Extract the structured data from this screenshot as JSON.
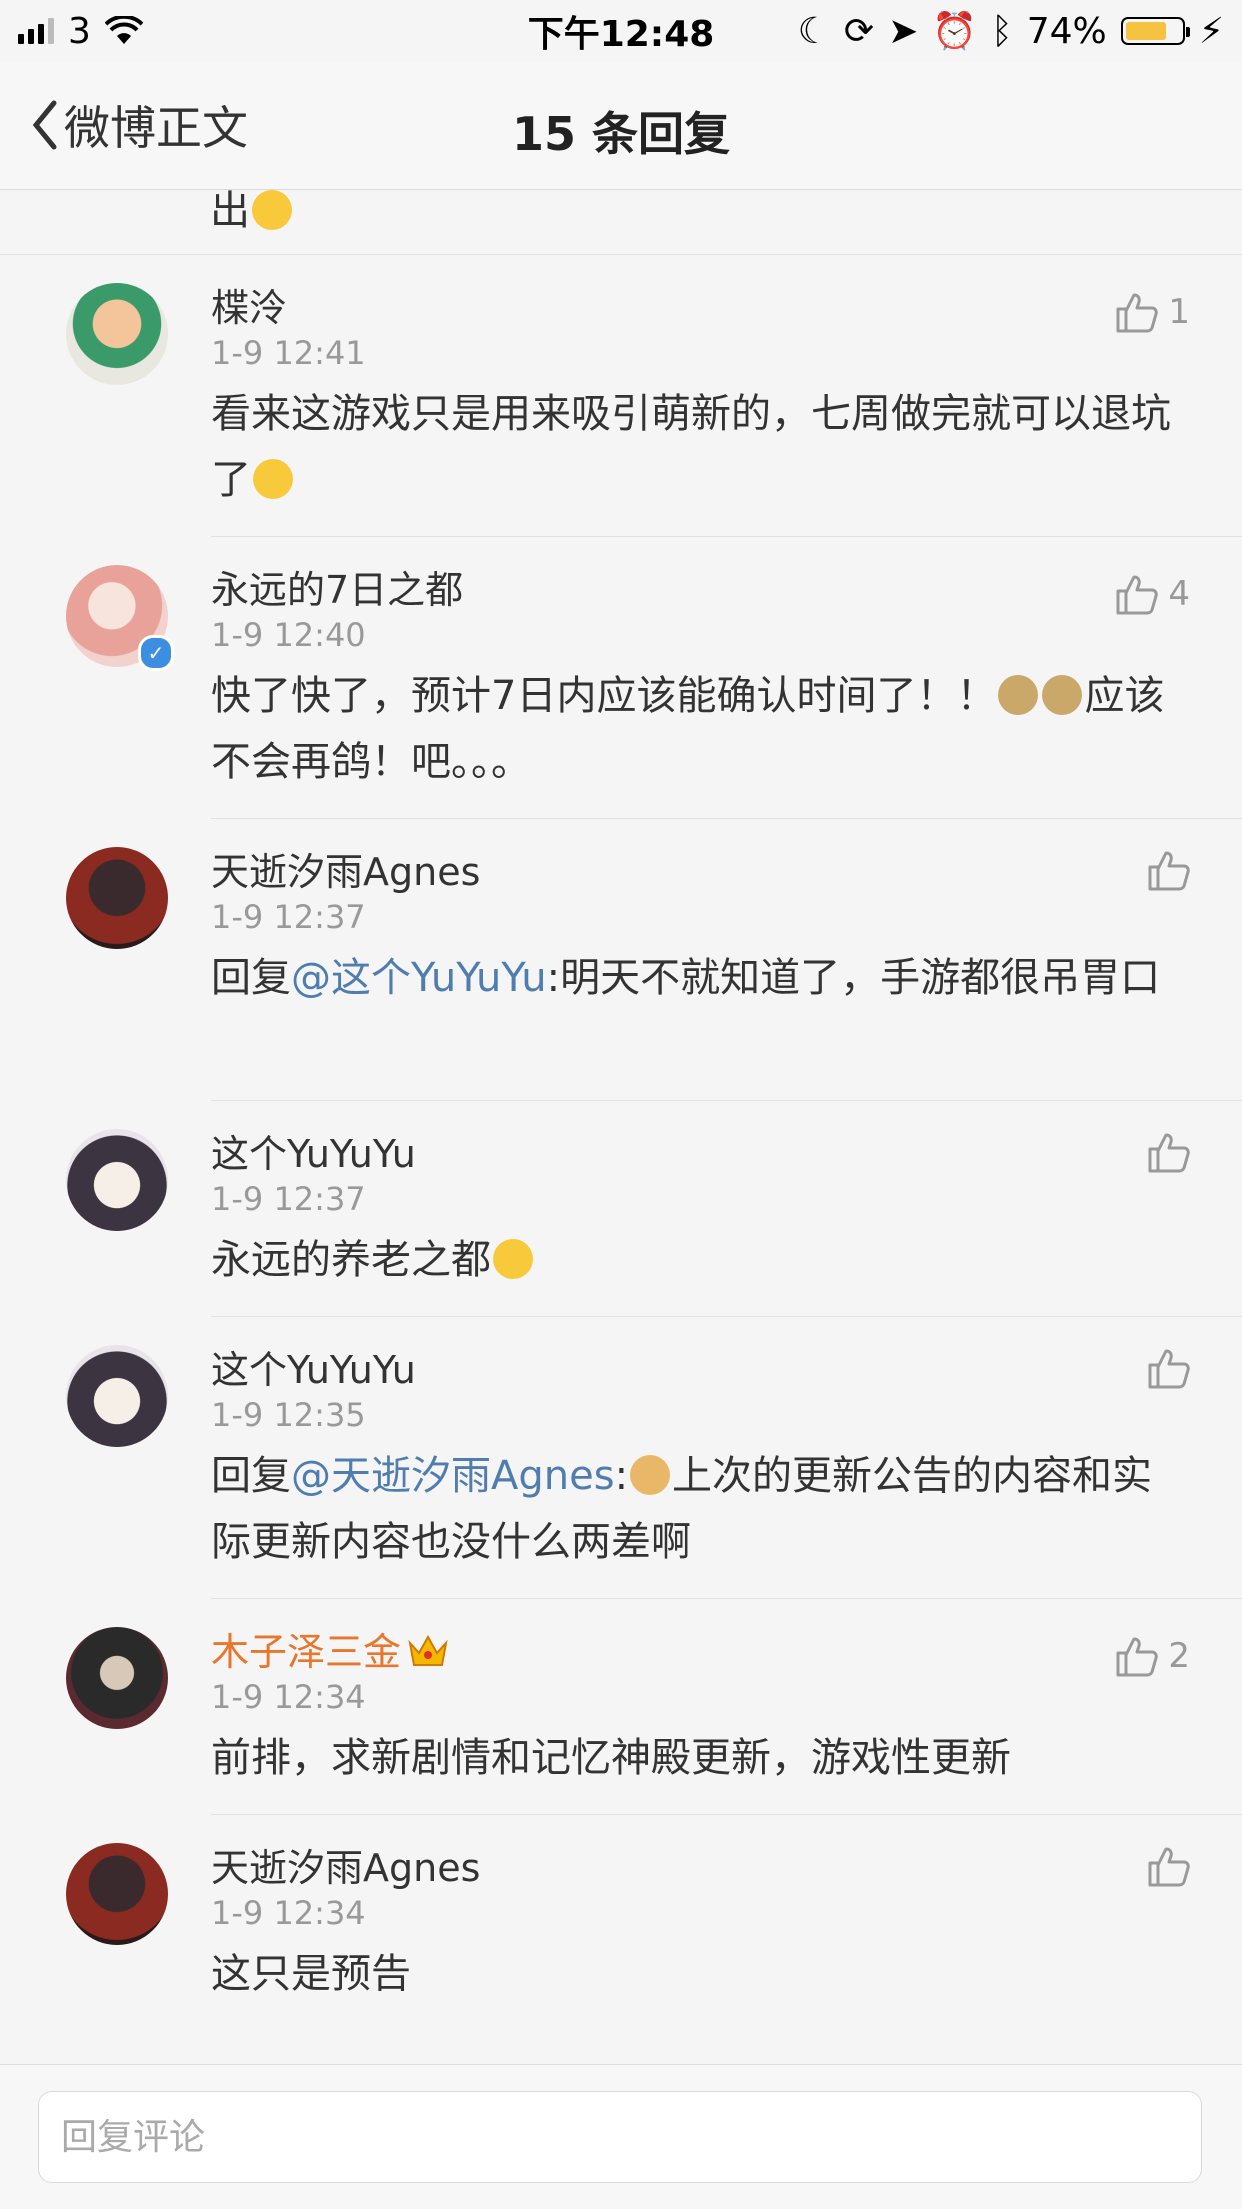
{
  "status_bar": {
    "carrier": "3",
    "time": "下午12:48",
    "battery": "74%",
    "battery_level": 0.74
  },
  "nav": {
    "back_label": "微博正文",
    "title": "15 条回复"
  },
  "partial_text": "出",
  "comments": [
    {
      "name": "楪泠",
      "time": "1-9 12:41",
      "likes": "1",
      "text": "看来这游戏只是用来吸引萌新的，七周做完就可以退坑了"
    },
    {
      "name": "永远的7日之都",
      "time": "1-9 12:40",
      "likes": "4",
      "text": "快了快了，预计7日内应该能确认时间了！！",
      "text_after": "应该不会再鸽！吧。。。"
    },
    {
      "name": "天逝汐雨Agnes",
      "time": "1-9 12:37",
      "likes": "",
      "prefix": "回复",
      "mention": "@这个YuYuYu",
      "text": ":明天不就知道了，手游都很吊胃口"
    },
    {
      "name": "这个YuYuYu",
      "time": "1-9 12:37",
      "likes": "",
      "text": "永远的养老之都"
    },
    {
      "name": "这个YuYuYu",
      "time": "1-9 12:35",
      "likes": "",
      "prefix": "回复",
      "mention": "@天逝汐雨Agnes",
      "text": ":",
      "text_after": "上次的更新公告的内容和实际更新内容也没什么两差啊"
    },
    {
      "name": "木子泽三金",
      "time": "1-9 12:34",
      "likes": "2",
      "text": "前排，求新剧情和记忆神殿更新，游戏性更新"
    },
    {
      "name": "天逝汐雨Agnes",
      "time": "1-9 12:34",
      "likes": "",
      "text": "这只是预告"
    }
  ],
  "reply": {
    "placeholder": "回复评论"
  },
  "colors": {
    "mention": "#507daf",
    "vip_name": "#e8762c",
    "verified": "#3b8ee0"
  }
}
